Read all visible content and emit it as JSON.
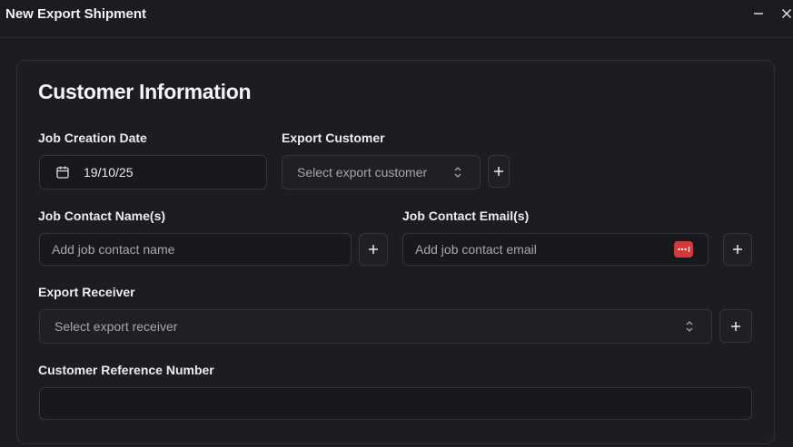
{
  "window": {
    "title": "New Export Shipment",
    "minimize_icon": "minimize-icon",
    "close_icon": "close-icon"
  },
  "section": {
    "title": "Customer Information"
  },
  "job_creation_date": {
    "label": "Job Creation Date",
    "value": "19/10/25",
    "icon": "calendar-icon"
  },
  "export_customer": {
    "label": "Export Customer",
    "placeholder": "Select export customer",
    "icon": "chevron-updown-icon",
    "add_icon": "plus-icon"
  },
  "job_contact_name": {
    "label": "Job Contact Name(s)",
    "placeholder": "Add job contact name",
    "add_icon": "plus-icon"
  },
  "job_contact_email": {
    "label": "Job Contact Email(s)",
    "placeholder": "Add job contact email",
    "badge_icon": "password-manager-icon",
    "add_icon": "plus-icon"
  },
  "export_receiver": {
    "label": "Export Receiver",
    "placeholder": "Select export receiver",
    "icon": "chevron-updown-icon",
    "add_icon": "plus-icon"
  },
  "customer_reference": {
    "label": "Customer Reference Number",
    "value": ""
  },
  "colors": {
    "background": "#1b1c20",
    "border": "#34353b",
    "badge": "#d6393a"
  }
}
